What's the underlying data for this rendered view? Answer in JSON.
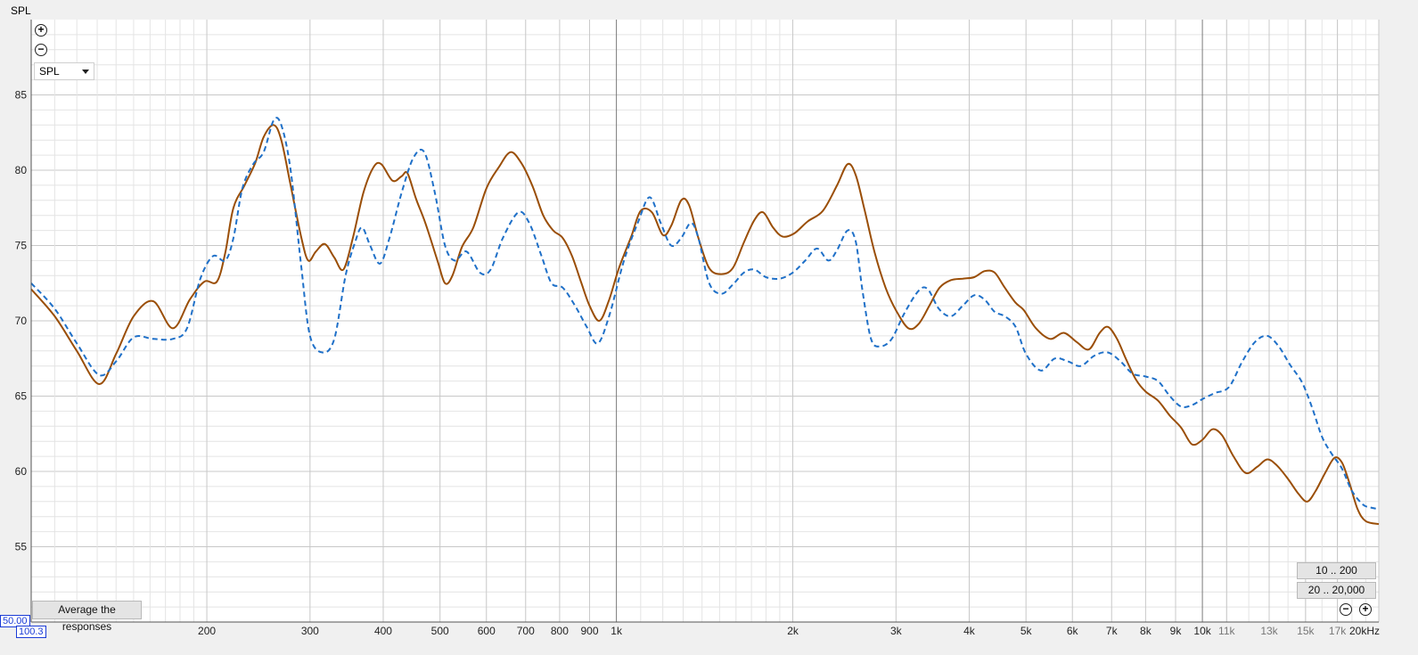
{
  "header": {
    "axis_title": "SPL"
  },
  "controls": {
    "zoom_in_icon": "zoom-in-icon",
    "zoom_out_icon": "zoom-out-icon",
    "dropdown_value": "SPL",
    "average_button": "Average the responses",
    "range_buttons": [
      "10 .. 200",
      "20 .. 20,000"
    ]
  },
  "readouts": {
    "y_min": "50.00",
    "x_min": "100.3"
  },
  "colors": {
    "background": "#ffffff",
    "grid_major": "#c8c8c8",
    "grid_minor": "#e4e4e4",
    "series_solid": "#9a4e07",
    "series_dashed": "#1f70c8"
  },
  "chart_data": {
    "type": "line",
    "x_scale": "log",
    "xlim": [
      100.3,
      20000
    ],
    "ylim": [
      50,
      90
    ],
    "ylabel": "SPL",
    "xunit": "kHz",
    "grid": true,
    "y_ticks": [
      55,
      60,
      65,
      70,
      75,
      80,
      85
    ],
    "x_ticks": [
      {
        "v": 200,
        "label": "200"
      },
      {
        "v": 300,
        "label": "300"
      },
      {
        "v": 400,
        "label": "400"
      },
      {
        "v": 500,
        "label": "500"
      },
      {
        "v": 600,
        "label": "600"
      },
      {
        "v": 700,
        "label": "700"
      },
      {
        "v": 800,
        "label": "800"
      },
      {
        "v": 900,
        "label": "900"
      },
      {
        "v": 1000,
        "label": "1k"
      },
      {
        "v": 2000,
        "label": "2k"
      },
      {
        "v": 3000,
        "label": "3k"
      },
      {
        "v": 4000,
        "label": "4k"
      },
      {
        "v": 5000,
        "label": "5k"
      },
      {
        "v": 6000,
        "label": "6k"
      },
      {
        "v": 7000,
        "label": "7k"
      },
      {
        "v": 8000,
        "label": "8k"
      },
      {
        "v": 9000,
        "label": "9k"
      },
      {
        "v": 10000,
        "label": "10k"
      },
      {
        "v": 11000,
        "label": "11k"
      },
      {
        "v": 13000,
        "label": "13k"
      },
      {
        "v": 15000,
        "label": "15k"
      },
      {
        "v": 17000,
        "label": "17k"
      },
      {
        "v": 20000,
        "label": "20kHz"
      }
    ],
    "series": [
      {
        "style": "solid",
        "color": "#9a4e07",
        "points": [
          [
            100.3,
            72.1
          ],
          [
            110,
            70.3
          ],
          [
            120,
            68.0
          ],
          [
            131,
            65.8
          ],
          [
            140,
            67.8
          ],
          [
            150,
            70.3
          ],
          [
            162,
            71.3
          ],
          [
            175,
            69.5
          ],
          [
            187,
            71.4
          ],
          [
            198,
            72.6
          ],
          [
            208,
            72.6
          ],
          [
            215,
            74.5
          ],
          [
            222,
            77.5
          ],
          [
            232,
            79.0
          ],
          [
            242,
            80.5
          ],
          [
            250,
            82.2
          ],
          [
            260,
            83.0
          ],
          [
            268,
            82.0
          ],
          [
            278,
            79.0
          ],
          [
            290,
            75.5
          ],
          [
            298,
            74.0
          ],
          [
            307,
            74.6
          ],
          [
            318,
            75.1
          ],
          [
            330,
            74.2
          ],
          [
            342,
            73.4
          ],
          [
            355,
            75.5
          ],
          [
            370,
            78.5
          ],
          [
            385,
            80.2
          ],
          [
            397,
            80.4
          ],
          [
            415,
            79.3
          ],
          [
            430,
            79.6
          ],
          [
            440,
            79.8
          ],
          [
            455,
            78.1
          ],
          [
            472,
            76.5
          ],
          [
            495,
            74.0
          ],
          [
            510,
            72.5
          ],
          [
            525,
            73.0
          ],
          [
            545,
            74.9
          ],
          [
            570,
            76.2
          ],
          [
            600,
            78.8
          ],
          [
            630,
            80.2
          ],
          [
            660,
            81.2
          ],
          [
            690,
            80.4
          ],
          [
            720,
            78.9
          ],
          [
            750,
            77.0
          ],
          [
            780,
            76.0
          ],
          [
            810,
            75.5
          ],
          [
            840,
            74.3
          ],
          [
            870,
            72.6
          ],
          [
            900,
            71.0
          ],
          [
            935,
            70.0
          ],
          [
            970,
            71.3
          ],
          [
            1010,
            73.5
          ],
          [
            1060,
            75.6
          ],
          [
            1100,
            77.3
          ],
          [
            1150,
            77.2
          ],
          [
            1200,
            75.7
          ],
          [
            1240,
            76.3
          ],
          [
            1290,
            78.0
          ],
          [
            1330,
            77.7
          ],
          [
            1380,
            75.5
          ],
          [
            1440,
            73.5
          ],
          [
            1510,
            73.1
          ],
          [
            1580,
            73.5
          ],
          [
            1650,
            75.2
          ],
          [
            1720,
            76.7
          ],
          [
            1780,
            77.2
          ],
          [
            1850,
            76.2
          ],
          [
            1920,
            75.6
          ],
          [
            2010,
            75.8
          ],
          [
            2120,
            76.6
          ],
          [
            2250,
            77.3
          ],
          [
            2380,
            79.0
          ],
          [
            2480,
            80.4
          ],
          [
            2560,
            79.7
          ],
          [
            2650,
            77.4
          ],
          [
            2760,
            74.5
          ],
          [
            2880,
            72.2
          ],
          [
            3000,
            70.7
          ],
          [
            3150,
            69.5
          ],
          [
            3280,
            69.8
          ],
          [
            3420,
            71.0
          ],
          [
            3560,
            72.2
          ],
          [
            3720,
            72.7
          ],
          [
            3900,
            72.8
          ],
          [
            4080,
            72.9
          ],
          [
            4250,
            73.3
          ],
          [
            4420,
            73.2
          ],
          [
            4600,
            72.2
          ],
          [
            4800,
            71.2
          ],
          [
            4960,
            70.7
          ],
          [
            5200,
            69.5
          ],
          [
            5500,
            68.8
          ],
          [
            5800,
            69.2
          ],
          [
            6100,
            68.6
          ],
          [
            6400,
            68.1
          ],
          [
            6680,
            69.2
          ],
          [
            6900,
            69.6
          ],
          [
            7150,
            68.8
          ],
          [
            7400,
            67.5
          ],
          [
            7700,
            66.1
          ],
          [
            8000,
            65.3
          ],
          [
            8400,
            64.7
          ],
          [
            8800,
            63.7
          ],
          [
            9200,
            62.9
          ],
          [
            9600,
            61.8
          ],
          [
            10000,
            62.1
          ],
          [
            10400,
            62.8
          ],
          [
            10800,
            62.4
          ],
          [
            11300,
            61.0
          ],
          [
            11850,
            59.9
          ],
          [
            12400,
            60.3
          ],
          [
            12900,
            60.8
          ],
          [
            13400,
            60.4
          ],
          [
            14000,
            59.5
          ],
          [
            14600,
            58.5
          ],
          [
            15100,
            58.0
          ],
          [
            15600,
            58.7
          ],
          [
            16200,
            59.9
          ],
          [
            16800,
            60.9
          ],
          [
            17300,
            60.6
          ],
          [
            17800,
            59.3
          ],
          [
            18400,
            57.5
          ],
          [
            19000,
            56.7
          ],
          [
            20000,
            56.5
          ]
        ]
      },
      {
        "style": "dashed",
        "color": "#1f70c8",
        "points": [
          [
            100.3,
            72.5
          ],
          [
            110,
            70.8
          ],
          [
            120,
            68.5
          ],
          [
            131,
            66.4
          ],
          [
            140,
            67.3
          ],
          [
            150,
            68.9
          ],
          [
            162,
            68.8
          ],
          [
            175,
            68.8
          ],
          [
            185,
            69.5
          ],
          [
            195,
            72.8
          ],
          [
            205,
            74.3
          ],
          [
            215,
            74.0
          ],
          [
            222,
            75.5
          ],
          [
            230,
            78.8
          ],
          [
            240,
            80.4
          ],
          [
            250,
            81.2
          ],
          [
            260,
            83.3
          ],
          [
            268,
            83.0
          ],
          [
            278,
            80.0
          ],
          [
            290,
            73.5
          ],
          [
            300,
            69.0
          ],
          [
            315,
            67.9
          ],
          [
            330,
            68.8
          ],
          [
            345,
            73.0
          ],
          [
            358,
            75.2
          ],
          [
            368,
            76.2
          ],
          [
            380,
            75.0
          ],
          [
            395,
            73.8
          ],
          [
            410,
            75.5
          ],
          [
            430,
            78.5
          ],
          [
            450,
            80.8
          ],
          [
            470,
            81.2
          ],
          [
            490,
            78.5
          ],
          [
            510,
            75.0
          ],
          [
            530,
            74.0
          ],
          [
            555,
            74.6
          ],
          [
            585,
            73.2
          ],
          [
            610,
            73.4
          ],
          [
            640,
            75.5
          ],
          [
            680,
            77.2
          ],
          [
            710,
            76.5
          ],
          [
            745,
            74.3
          ],
          [
            775,
            72.5
          ],
          [
            810,
            72.2
          ],
          [
            850,
            71.0
          ],
          [
            890,
            69.6
          ],
          [
            930,
            68.5
          ],
          [
            975,
            70.5
          ],
          [
            1030,
            74.0
          ],
          [
            1090,
            76.6
          ],
          [
            1140,
            78.2
          ],
          [
            1190,
            76.5
          ],
          [
            1240,
            75.0
          ],
          [
            1290,
            75.5
          ],
          [
            1340,
            76.5
          ],
          [
            1380,
            75.5
          ],
          [
            1440,
            72.5
          ],
          [
            1510,
            71.8
          ],
          [
            1580,
            72.4
          ],
          [
            1650,
            73.2
          ],
          [
            1720,
            73.4
          ],
          [
            1800,
            72.9
          ],
          [
            1900,
            72.8
          ],
          [
            2000,
            73.2
          ],
          [
            2100,
            74.0
          ],
          [
            2200,
            74.8
          ],
          [
            2300,
            74.0
          ],
          [
            2380,
            74.7
          ],
          [
            2480,
            76.0
          ],
          [
            2560,
            75.3
          ],
          [
            2630,
            72.0
          ],
          [
            2720,
            68.8
          ],
          [
            2820,
            68.3
          ],
          [
            2950,
            68.8
          ],
          [
            3100,
            70.5
          ],
          [
            3280,
            72.0
          ],
          [
            3400,
            72.1
          ],
          [
            3550,
            70.8
          ],
          [
            3720,
            70.3
          ],
          [
            3900,
            71.0
          ],
          [
            4080,
            71.7
          ],
          [
            4250,
            71.4
          ],
          [
            4420,
            70.6
          ],
          [
            4600,
            70.3
          ],
          [
            4800,
            69.6
          ],
          [
            5000,
            67.8
          ],
          [
            5300,
            66.7
          ],
          [
            5600,
            67.5
          ],
          [
            5900,
            67.3
          ],
          [
            6200,
            67.0
          ],
          [
            6550,
            67.7
          ],
          [
            6900,
            67.9
          ],
          [
            7250,
            67.3
          ],
          [
            7600,
            66.5
          ],
          [
            8000,
            66.3
          ],
          [
            8400,
            66.0
          ],
          [
            8800,
            65.0
          ],
          [
            9200,
            64.3
          ],
          [
            9600,
            64.4
          ],
          [
            10000,
            64.8
          ],
          [
            10500,
            65.2
          ],
          [
            11100,
            65.6
          ],
          [
            11700,
            67.3
          ],
          [
            12300,
            68.6
          ],
          [
            12900,
            69.0
          ],
          [
            13500,
            68.3
          ],
          [
            14100,
            67.1
          ],
          [
            14800,
            65.9
          ],
          [
            15400,
            64.2
          ],
          [
            16000,
            62.3
          ],
          [
            16600,
            61.2
          ],
          [
            17300,
            60.2
          ],
          [
            18000,
            58.7
          ],
          [
            18800,
            57.8
          ],
          [
            19400,
            57.6
          ],
          [
            20000,
            57.5
          ]
        ]
      }
    ]
  }
}
